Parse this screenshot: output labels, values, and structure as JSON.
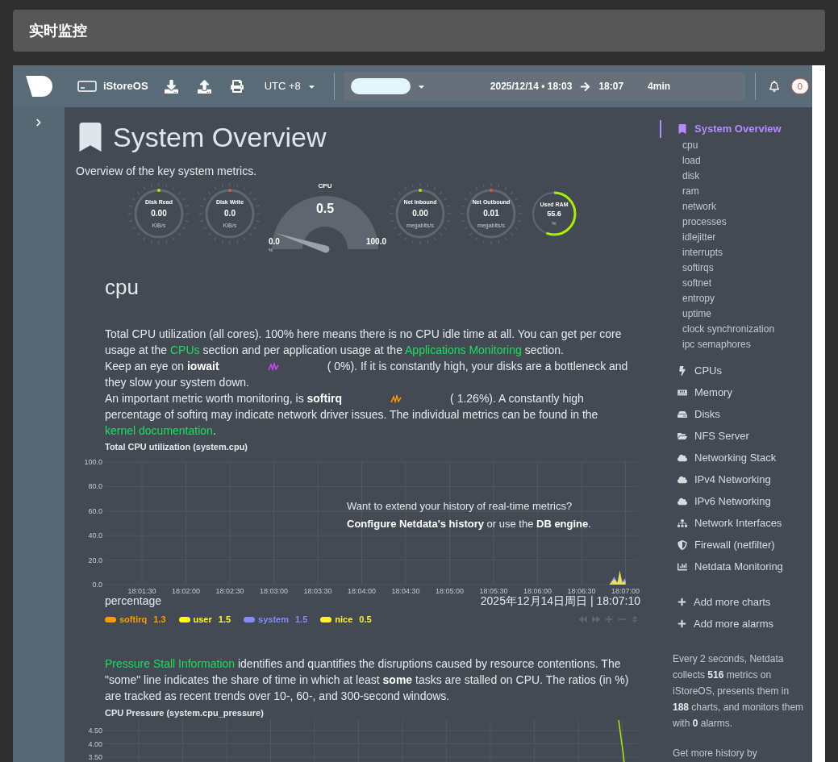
{
  "header": {
    "title": "实时监控"
  },
  "toolbar": {
    "host": "iStoreOS",
    "timezone": "UTC +8",
    "playing": true,
    "range_start": "2025/12/14 • 18:03",
    "range_end": "18:07",
    "duration": "4min",
    "alarm_count": "0"
  },
  "overview": {
    "title": "System Overview",
    "subtitle": "Overview of the key system metrics.",
    "gauges": [
      {
        "kind": "dial",
        "title": "Disk Read",
        "value": "0.00",
        "unit": "KiB/s",
        "color": "#aaee00"
      },
      {
        "kind": "dial",
        "title": "Disk Write",
        "value": "0.0",
        "unit": "KiB/s",
        "color": "#e05a3a"
      },
      {
        "kind": "arc",
        "title": "CPU",
        "value": "0.5",
        "min": "0.0",
        "max": "100.0",
        "unit": "%"
      },
      {
        "kind": "dial",
        "title": "Net Inbound",
        "value": "0.00",
        "unit": "megabits/s",
        "color": "#aaee00"
      },
      {
        "kind": "dial",
        "title": "Net Outbound",
        "value": "0.01",
        "unit": "megabits/s",
        "color": "#e05a3a"
      },
      {
        "kind": "ring",
        "title": "Used RAM",
        "value": "55.6",
        "unit": "%"
      }
    ]
  },
  "section": {
    "title": "cpu",
    "paragraphs": [
      [
        {
          "kind": "text",
          "text": "Total CPU utilization (all cores). 100% here means there is no CPU idle time at all. You can get per core usage at the "
        },
        {
          "kind": "link",
          "text": "CPUs"
        },
        {
          "kind": "text",
          "text": " section and per application usage at the "
        },
        {
          "kind": "link",
          "text": "Applications Monitoring"
        },
        {
          "kind": "text",
          "text": " section."
        }
      ],
      [
        {
          "kind": "text",
          "text": "Keep an eye on **iowait**"
        },
        {
          "kind": "spark",
          "color": "#cc44ff"
        },
        {
          "kind": "text",
          "text": "( 0%). If it is constantly high, your disks are a bottleneck and they slow your system down."
        }
      ],
      [
        {
          "kind": "text",
          "text": "An important metric worth monitoring, is **softirq**"
        },
        {
          "kind": "spark",
          "color": "#ff9900"
        },
        {
          "kind": "text",
          "text": "( 1.26%). A constantly high percentage of softirq may indicate network driver issues. The individual metrics can be found in the "
        },
        {
          "kind": "link",
          "text": "kernel documentation"
        },
        {
          "kind": "text",
          "text": "."
        }
      ]
    ]
  },
  "cpu_chart": {
    "title": "Total CPU utilization (system.cpu)",
    "overlay": [
      "Want to extend your history of real-time metrics?",
      "**Configure Netdata's history** or use the **DB engine**."
    ],
    "units": "percentage",
    "timestamp": "2025年12月14日周日 | 18:07:10",
    "legend": [
      {
        "name": "softirq",
        "value": "1.3",
        "color": "#ff9900"
      },
      {
        "name": "user",
        "value": "1.5",
        "color": "#ffff00"
      },
      {
        "name": "system",
        "value": "1.5",
        "color": "#8888ff"
      },
      {
        "name": "nice",
        "value": "0.5",
        "color": "#ffee33"
      }
    ],
    "chart_data": {
      "type": "area",
      "grid": true,
      "x": [
        "18:01:30",
        "18:02:00",
        "18:02:30",
        "18:03:00",
        "18:03:30",
        "18:04:00",
        "18:04:30",
        "18:05:00",
        "18:05:30",
        "18:06:00",
        "18:06:30",
        "18:07:00"
      ],
      "ylim": [
        0,
        100
      ],
      "yticks": [
        {
          "value": 0,
          "label": "0.0"
        },
        {
          "value": 20,
          "label": "20.0"
        },
        {
          "value": 40,
          "label": "40.0"
        },
        {
          "value": 60,
          "label": "60.0"
        },
        {
          "value": 80,
          "label": "80.0"
        },
        {
          "value": 100,
          "label": "100.0"
        }
      ]
    }
  },
  "pressure": {
    "paragraph": [
      {
        "kind": "link",
        "text": "Pressure Stall Information"
      },
      {
        "kind": "text",
        "text": " identifies and quantifies the disruptions caused by resource contentions. The \"some\" line indicates the share of time in which at least **some** tasks are stalled on CPU. The ratios (in %) are tracked as recent trends over 10-, 60-, and 300-second windows."
      }
    ],
    "chart_title": "CPU Pressure (system.cpu_pressure)",
    "axis_labels": [
      "4.50",
      "4.00",
      "3.50"
    ]
  },
  "sidebar": {
    "sections": [
      {
        "label": "System Overview",
        "selected": true,
        "children": [
          "cpu",
          "load",
          "disk",
          "ram",
          "network",
          "processes",
          "idlejitter",
          "interrupts",
          "softirqs",
          "softnet",
          "entropy",
          "uptime",
          "clock synchronization",
          "ipc semaphores"
        ]
      },
      {
        "label": "CPUs",
        "selected": false
      },
      {
        "label": "Memory",
        "selected": false
      },
      {
        "label": "Disks",
        "selected": false
      },
      {
        "label": "NFS Server",
        "selected": false
      },
      {
        "label": "Networking Stack",
        "selected": false
      },
      {
        "label": "IPv4 Networking",
        "selected": false
      },
      {
        "label": "IPv6 Networking",
        "selected": false
      },
      {
        "label": "Network Interfaces",
        "selected": false
      },
      {
        "label": "Firewall (netfilter)",
        "selected": false
      },
      {
        "label": "Netdata Monitoring",
        "selected": false
      }
    ],
    "actions": [
      "Add more charts",
      "Add more alarms"
    ],
    "info": "Every 2 seconds, Netdata collects **516** metrics on iStoreOS, presents them in **188** charts, and monitors them with **0** alarms.",
    "footer": "Get more history by"
  }
}
